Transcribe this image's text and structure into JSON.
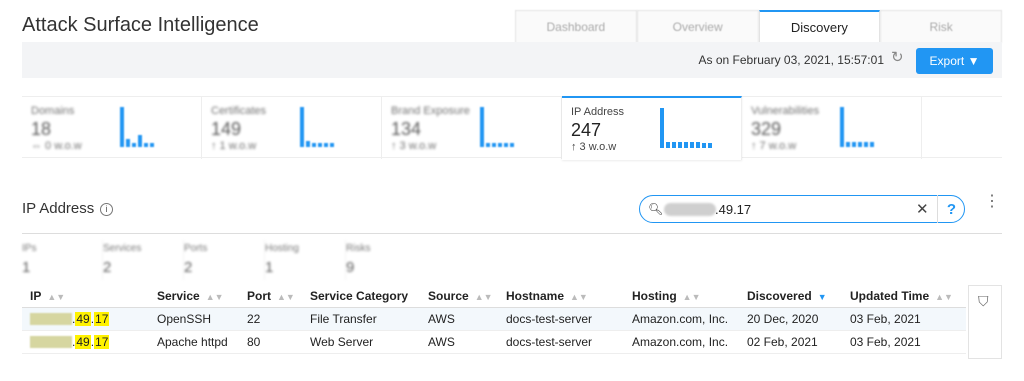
{
  "app": {
    "title": "Attack Surface Intelligence"
  },
  "tabs": [
    {
      "label": "Dashboard",
      "active": false
    },
    {
      "label": "Overview",
      "active": false
    },
    {
      "label": "Discovery",
      "active": true
    },
    {
      "label": "Risk",
      "active": false
    }
  ],
  "toolbar": {
    "as_on": "As on February 03, 2021, 15:57:01",
    "export_label": "Export ▼"
  },
  "cards": [
    {
      "label": "Domains",
      "value": "18",
      "wow": "⇔ 0 w.o.w",
      "bars": [
        1,
        0.2,
        0.1,
        0.3,
        0.1,
        0.1
      ],
      "active": false
    },
    {
      "label": "Certificates",
      "value": "149",
      "wow": "↑ 1 w.o.w",
      "bars": [
        1,
        0.15,
        0.1,
        0.1,
        0.1,
        0.1
      ],
      "active": false
    },
    {
      "label": "Brand Exposure",
      "value": "134",
      "wow": "↑ 3 w.o.w",
      "bars": [
        1,
        0.1,
        0.1,
        0.1,
        0.1,
        0.1
      ],
      "active": false
    },
    {
      "label": "IP Address",
      "value": "247",
      "wow": "↑ 3 w.o.w",
      "bars": [
        1,
        0.15,
        0.15,
        0.15,
        0.15,
        0.15,
        0.15,
        0.12,
        0.12
      ],
      "active": true
    },
    {
      "label": "Vulnerabilities",
      "value": "329",
      "wow": "↑ 7 w.o.w",
      "bars": [
        1,
        0.12,
        0.12,
        0.12,
        0.12,
        0.12
      ],
      "active": false
    }
  ],
  "section": {
    "title": "IP Address",
    "info_glyph": "i"
  },
  "search": {
    "value": ".49.17",
    "help": "?"
  },
  "summary": [
    {
      "label": "IPs",
      "value": "1"
    },
    {
      "label": "Services",
      "value": "2"
    },
    {
      "label": "Ports",
      "value": "2"
    },
    {
      "label": "Hosting",
      "value": "1"
    },
    {
      "label": "Risks",
      "value": "9"
    }
  ],
  "table": {
    "columns": [
      "IP",
      "Service",
      "Port",
      "Service Category",
      "Source",
      "Hostname",
      "Hosting",
      "Discovered",
      "Updated Time"
    ],
    "rows": [
      {
        "ip_visible": ".49.17",
        "ip_part1": "49",
        "ip_part2": "17",
        "service": "OpenSSH",
        "port": "22",
        "category": "File Transfer",
        "source": "AWS",
        "hostname": "docs-test-server",
        "hosting": "Amazon.com, Inc.",
        "discovered": "20 Dec, 2020",
        "updated": "03 Feb, 2021"
      },
      {
        "ip_visible": ".49.17",
        "ip_part1": "49",
        "ip_part2": "17",
        "service": "Apache httpd",
        "port": "80",
        "category": "Web Server",
        "source": "AWS",
        "hostname": "docs-test-server",
        "hosting": "Amazon.com, Inc.",
        "discovered": "02 Feb, 2021",
        "updated": "03 Feb, 2021"
      }
    ]
  },
  "colors": {
    "accent": "#2196f3",
    "highlight": "#fff200"
  }
}
